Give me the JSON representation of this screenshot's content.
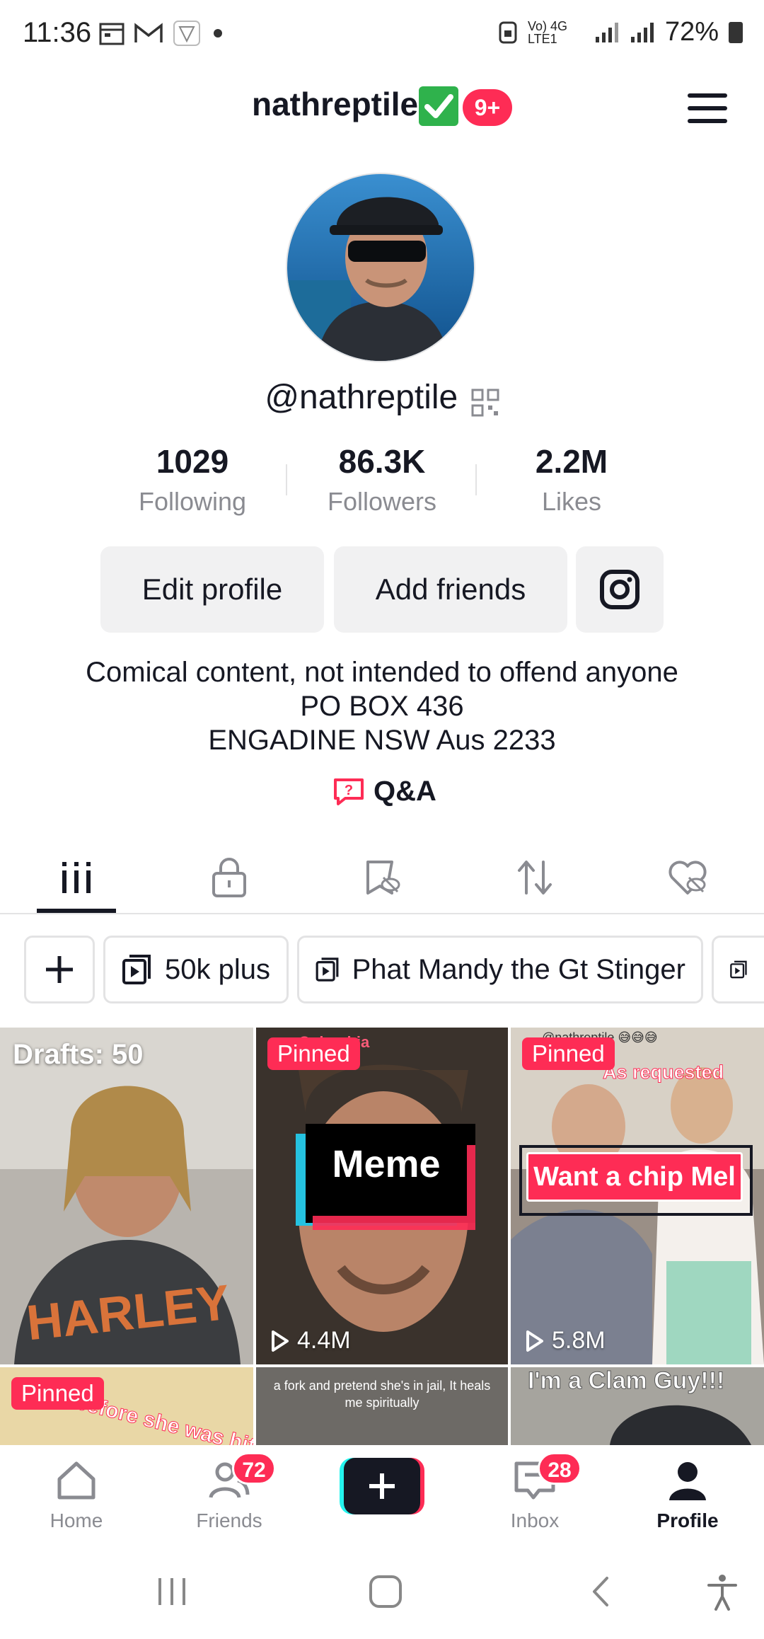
{
  "status_bar": {
    "time": "11:36",
    "network": "Vo) 4G LTE1",
    "battery": "72%"
  },
  "header": {
    "title": "nathreptile",
    "notification_badge": "9+"
  },
  "profile": {
    "handle": "@nathreptile",
    "stats": [
      {
        "value": "1029",
        "label": "Following"
      },
      {
        "value": "86.3K",
        "label": "Followers"
      },
      {
        "value": "2.2M",
        "label": "Likes"
      }
    ],
    "edit_profile_label": "Edit profile",
    "add_friends_label": "Add friends",
    "bio_lines": [
      "Comical content, not intended to offend anyone",
      "PO BOX 436",
      "ENGADINE NSW Aus 2233"
    ],
    "qa_label": "Q&A"
  },
  "tabs": [
    "videos-icon",
    "lock-icon",
    "tagged-icon",
    "repost-icon",
    "liked-icon"
  ],
  "playlists": {
    "items": [
      "50k plus",
      "Phat Mandy the Gt Stinger"
    ]
  },
  "grid": {
    "drafts_label": "Drafts: 50",
    "pinned_label": "Pinned",
    "cells": [
      {
        "overlay_top": "Columbia",
        "overlay_text": "Meme",
        "views": "4.4M"
      },
      {
        "overlay_top": "@nathreptile 😅😅😅",
        "caption_top": "As requested",
        "overlay_text": "Want a chip Mel",
        "views": "5.8M"
      },
      {
        "overlay_text": "me before she was hit by a car!"
      },
      {
        "overlay_text": "a fork and pretend she's in jail, It heals me spiritually"
      },
      {
        "overlay_text": "I'm a Clam Guy!!!"
      }
    ]
  },
  "bottom_nav": {
    "home": "Home",
    "friends": "Friends",
    "friends_badge": "72",
    "inbox": "Inbox",
    "inbox_badge": "28",
    "profile": "Profile"
  },
  "colors": {
    "accent": "#fe2c55",
    "text": "#161823",
    "muted": "#8a8b91",
    "button_bg": "#f1f1f2"
  }
}
